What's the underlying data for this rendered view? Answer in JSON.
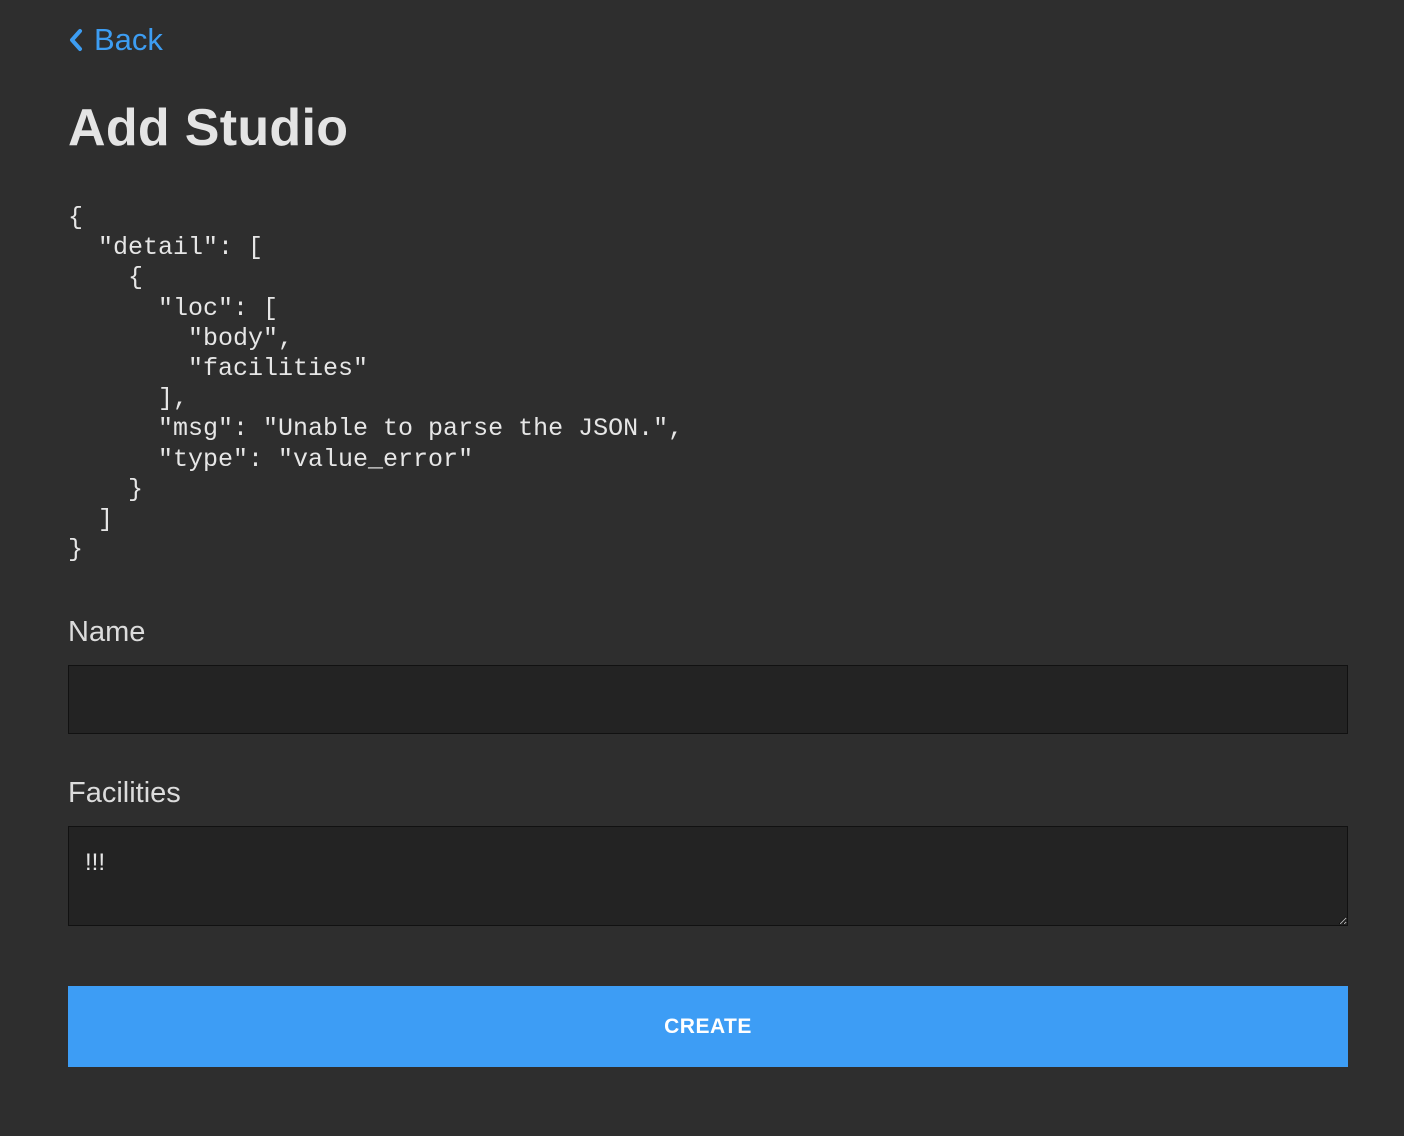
{
  "nav": {
    "back_label": "Back"
  },
  "page": {
    "title": "Add Studio"
  },
  "error": {
    "text": "{\n  \"detail\": [\n    {\n      \"loc\": [\n        \"body\",\n        \"facilities\"\n      ],\n      \"msg\": \"Unable to parse the JSON.\",\n      \"type\": \"value_error\"\n    }\n  ]\n}"
  },
  "form": {
    "name_label": "Name",
    "name_value": "",
    "facilities_label": "Facilities",
    "facilities_value": "!!!",
    "submit_label": "CREATE"
  },
  "colors": {
    "background": "#2e2e2e",
    "accent": "#3d9df5",
    "input_background": "#232323"
  },
  "icons": {
    "back": "chevron-left-icon"
  }
}
